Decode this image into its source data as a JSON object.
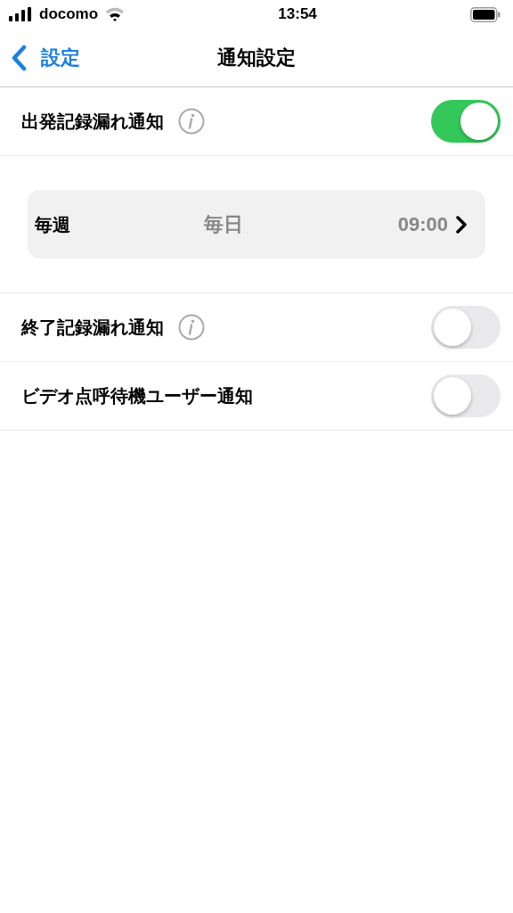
{
  "status_bar": {
    "carrier": "docomo",
    "time": "13:54"
  },
  "nav": {
    "back_label": "設定",
    "title": "通知設定"
  },
  "settings": [
    {
      "kind": "toggle",
      "label": "出発記録漏れ通知",
      "info": true,
      "on": true
    },
    {
      "kind": "schedule",
      "frequency": "毎週",
      "day": "毎日",
      "time": "09:00"
    },
    {
      "kind": "toggle",
      "label": "終了記録漏れ通知",
      "info": true,
      "on": false
    },
    {
      "kind": "toggle",
      "label": "ビデオ点呼待機ユーザー通知",
      "info": false,
      "on": false
    }
  ]
}
